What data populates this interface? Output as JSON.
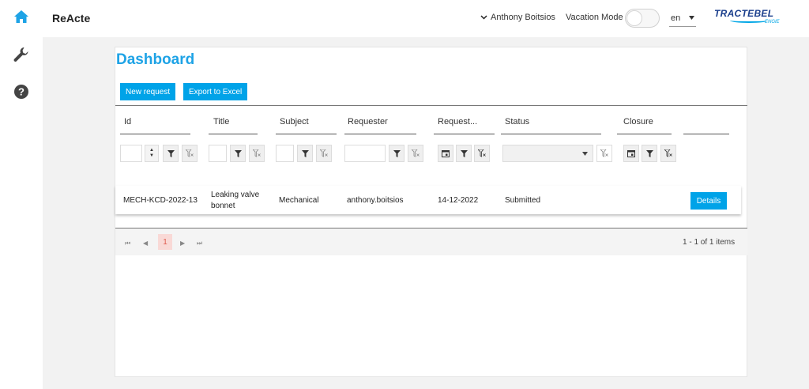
{
  "app": {
    "brand": "ReActe"
  },
  "header": {
    "user_name": "Anthony Boitsios",
    "vacation_label": "Vacation Mode",
    "language": "en",
    "logo_text": "TRACTEBEL",
    "logo_sub": "ENGIE"
  },
  "sidebar": {
    "items": [
      {
        "name": "home",
        "icon": "home-icon",
        "color": "#1ea3e6"
      },
      {
        "name": "tools",
        "icon": "wrench-icon",
        "color": "#444444"
      },
      {
        "name": "help",
        "icon": "help-icon",
        "color": "#444444"
      }
    ]
  },
  "page": {
    "title": "Dashboard",
    "new_request_label": "New request",
    "export_label": "Export to Excel"
  },
  "table": {
    "headers": {
      "id": "Id",
      "title": "Title",
      "subject": "Subject",
      "requester": "Requester",
      "request_date": "Request...",
      "status": "Status",
      "closure": "Closure"
    },
    "rows": [
      {
        "id": "MECH-KCD-2022-13",
        "title_line1": "Leaking valve",
        "title_line2": "bonnet",
        "subject": "Mechanical",
        "requester": "anthony.boitsios",
        "request_date": "14-12-2022",
        "status": "Submitted",
        "action": "Details"
      }
    ]
  },
  "pager": {
    "current_page": "1",
    "info": "1 - 1 of 1 items"
  },
  "colors": {
    "accent": "#00a3e8",
    "title": "#1ea3e6",
    "current_page_bg": "#f9d9d6"
  }
}
